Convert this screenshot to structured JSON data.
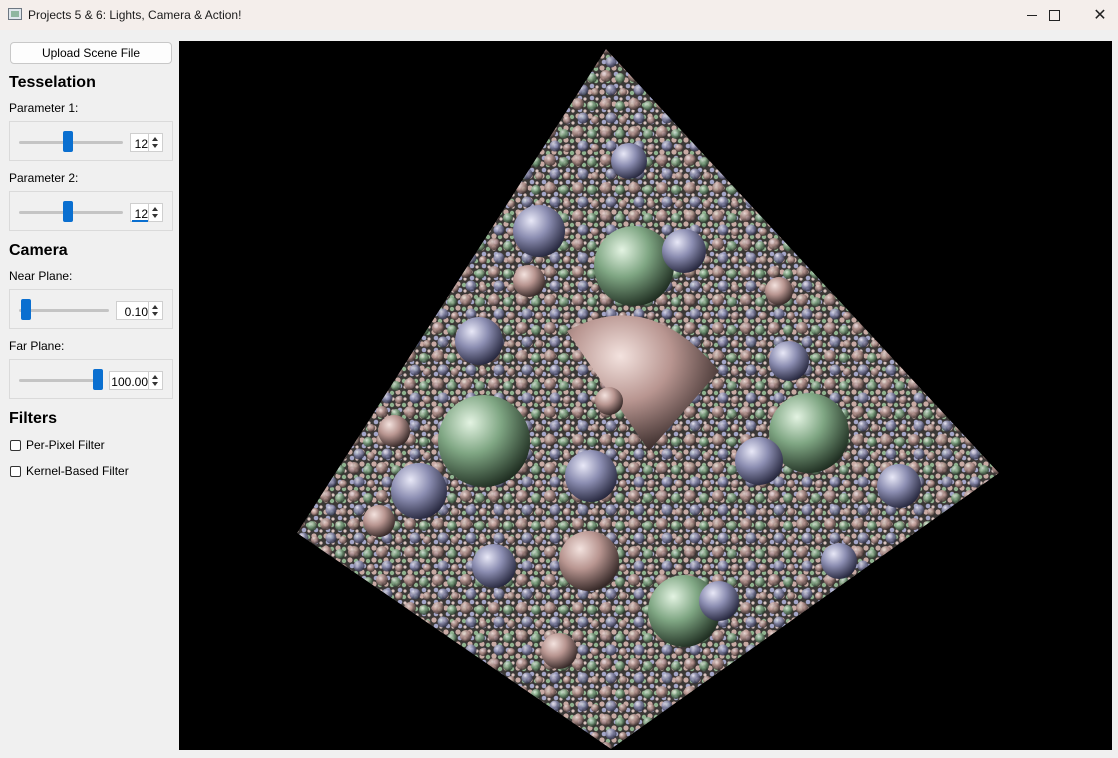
{
  "window": {
    "title": "Projects 5 & 6: Lights, Camera & Action!"
  },
  "sidebar": {
    "upload_label": "Upload Scene File",
    "tesselation": {
      "title": "Tesselation",
      "param1_label": "Parameter 1:",
      "param1_value": "12",
      "param1_fraction": 0.45,
      "param2_label": "Parameter 2:",
      "param2_value": "12",
      "param2_fraction": 0.45
    },
    "camera": {
      "title": "Camera",
      "near_label": "Near Plane:",
      "near_value": "0.10",
      "near_fraction": 0.0,
      "far_label": "Far Plane:",
      "far_value": "100.00",
      "far_fraction": 1.0
    },
    "filters": {
      "title": "Filters",
      "per_pixel_label": "Per-Pixel Filter",
      "per_pixel_checked": false,
      "kernel_label": "Kernel-Based Filter",
      "kernel_checked": false
    }
  },
  "viewport": {
    "render_colors": {
      "background": "#000000",
      "pink": "#b89590",
      "green": "#7fa683",
      "blue": "#8c8eb2"
    }
  },
  "colors": {
    "accent": "#0a6fd0"
  }
}
